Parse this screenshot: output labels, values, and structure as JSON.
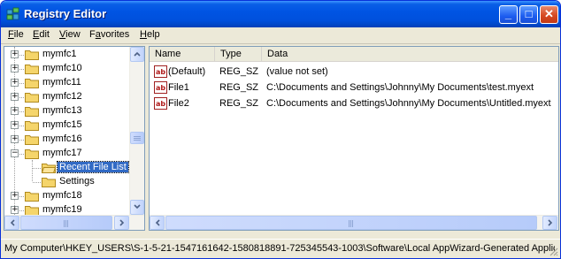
{
  "window": {
    "title": "Registry Editor"
  },
  "titlebar_buttons": {
    "minimize": "_",
    "maximize": "□",
    "close": "✕"
  },
  "menu": [
    {
      "label_u": "F",
      "label_rest": "ile"
    },
    {
      "label_u": "E",
      "label_rest": "dit"
    },
    {
      "label_u": "V",
      "label_rest": "iew"
    },
    {
      "label_u": "",
      "label_pre": "F",
      "label_u2": "a",
      "label_rest": "vorites"
    },
    {
      "label_u": "H",
      "label_rest": "elp"
    }
  ],
  "tree": {
    "items": [
      {
        "label": "mymfc1",
        "expander": "+"
      },
      {
        "label": "mymfc10",
        "expander": "+"
      },
      {
        "label": "mymfc11",
        "expander": "+"
      },
      {
        "label": "mymfc12",
        "expander": "+"
      },
      {
        "label": "mymfc13",
        "expander": "+"
      },
      {
        "label": "mymfc15",
        "expander": "+"
      },
      {
        "label": "mymfc16",
        "expander": "+"
      },
      {
        "label": "mymfc17",
        "expander": "−"
      },
      {
        "label": "Recent File List",
        "expander": "",
        "selected": true
      },
      {
        "label": "Settings",
        "expander": ""
      },
      {
        "label": "mymfc18",
        "expander": "+"
      },
      {
        "label": "mymfc19",
        "expander": "+"
      }
    ]
  },
  "list": {
    "columns": [
      "Name",
      "Type",
      "Data"
    ],
    "rows": [
      {
        "name": "(Default)",
        "type": "REG_SZ",
        "data": "(value not set)"
      },
      {
        "name": "File1",
        "type": "REG_SZ",
        "data": "C:\\Documents and Settings\\Johnny\\My Documents\\test.myext"
      },
      {
        "name": "File2",
        "type": "REG_SZ",
        "data": "C:\\Documents and Settings\\Johnny\\My Documents\\Untitled.myext"
      }
    ]
  },
  "status": {
    "path": "My Computer\\HKEY_USERS\\S-1-5-21-1547161642-1580818891-725345543-1003\\Software\\Local AppWizard-Generated Applic"
  },
  "colors": {
    "titlebar": "#0054e3",
    "selection": "#316ac5",
    "folder": "#f5d56b"
  }
}
